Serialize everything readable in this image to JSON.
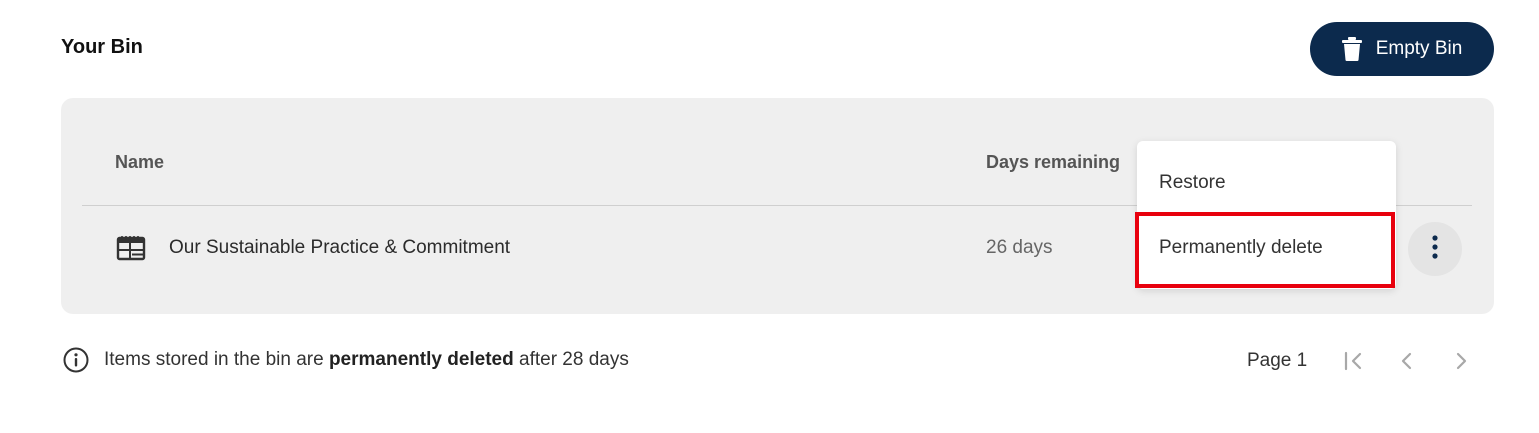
{
  "header": {
    "title": "Your Bin",
    "empty_bin_label": "Empty Bin"
  },
  "table": {
    "columns": [
      "Name",
      "Days remaining"
    ],
    "rows": [
      {
        "icon": "document-layout-icon",
        "name": "Our Sustainable Practice & Commitment",
        "days_remaining": "26 days"
      }
    ]
  },
  "context_menu": {
    "items": [
      "Restore",
      "Permanently delete"
    ],
    "highlighted": "Permanently delete"
  },
  "footer": {
    "info_prefix": "Items stored in the bin are ",
    "info_bold": "permanently deleted",
    "info_suffix": " after 28 days",
    "page_label": "Page 1"
  },
  "colors": {
    "primary": "#0c2a4d",
    "panel_bg": "#efefef",
    "highlight": "#e8000d"
  }
}
